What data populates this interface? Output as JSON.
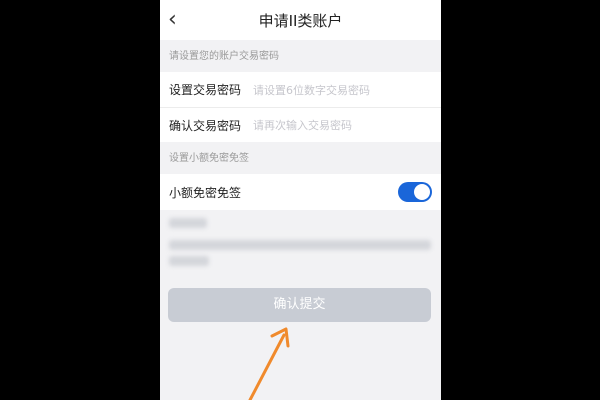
{
  "header": {
    "back_icon": "chevron-left-icon",
    "title": "申请II类账户"
  },
  "password_section": {
    "label": "请设置您的账户交易密码",
    "rows": [
      {
        "label": "设置交易密码",
        "placeholder": "请设置6位数字交易密码"
      },
      {
        "label": "确认交易密码",
        "placeholder": "请再次输入交易密码"
      }
    ]
  },
  "exempt_section": {
    "label": "设置小额免密免签",
    "toggle_label": "小额免密免签",
    "toggle_on": true
  },
  "submit_label": "确认提交",
  "colors": {
    "accent": "#1a66d9",
    "annotation_arrow": "#f08a2c",
    "submit_bg": "#c8ccd4"
  }
}
